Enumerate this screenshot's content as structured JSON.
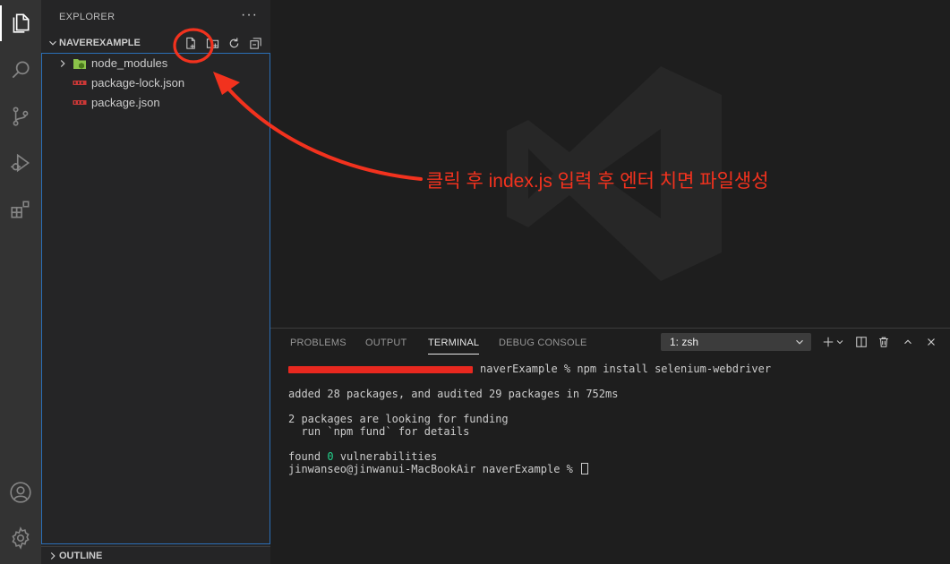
{
  "activity_bar": {
    "icons": [
      "files-icon",
      "search-icon",
      "source-control-icon",
      "run-debug-icon",
      "extensions-icon",
      "account-icon",
      "settings-gear-icon"
    ]
  },
  "sidebar": {
    "title": "EXPLORER",
    "more": "···",
    "folder": "NAVEREXAMPLE",
    "items": [
      {
        "label": "node_modules",
        "type": "folder"
      },
      {
        "label": "package-lock.json",
        "type": "json"
      },
      {
        "label": "package.json",
        "type": "json"
      }
    ],
    "outline": "OUTLINE"
  },
  "panel": {
    "tabs": [
      "PROBLEMS",
      "OUTPUT",
      "TERMINAL",
      "DEBUG CONSOLE"
    ],
    "active_tab": "TERMINAL",
    "terminal_selector": "1: zsh",
    "terminal": {
      "line1_cmd": "naverExample % npm install selenium-webdriver",
      "line2": "added 28 packages, and audited 29 packages in 752ms",
      "line3": "2 packages are looking for funding",
      "line4": "  run `npm fund` for details",
      "line5_pre": "found ",
      "line5_num": "0",
      "line5_post": " vulnerabilities",
      "line6": "jinwanseo@jinwanui-MacBookAir naverExample % "
    }
  },
  "annotation": {
    "text": "클릭 후 index.js 입력 후 엔터 치면 파일생성"
  },
  "colors": {
    "accent": "#2b6fb7",
    "annotation_red": "#f2321e",
    "terminal_green": "#23d18b"
  }
}
